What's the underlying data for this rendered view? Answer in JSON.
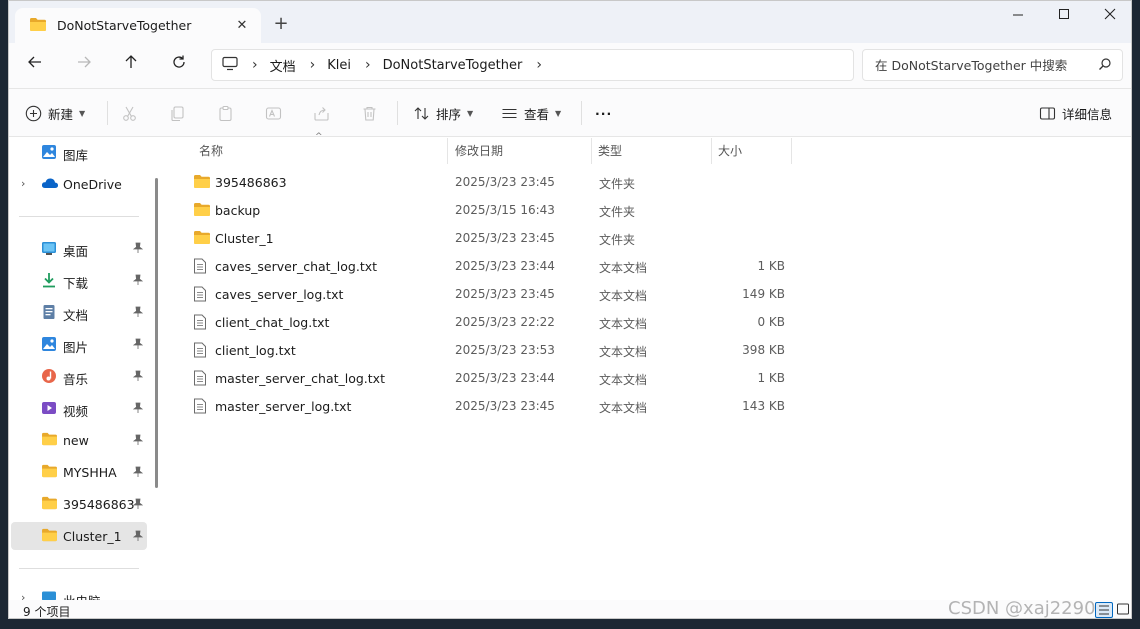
{
  "tab": {
    "title": "DoNotStarveTogether",
    "close_glyph": "✕",
    "new_tab_glyph": "+"
  },
  "window_controls": {
    "minimize": "—",
    "maximize": "☐",
    "close": "✕"
  },
  "breadcrumb": [
    "文档",
    "Klei",
    "DoNotStarveTogether"
  ],
  "search": {
    "placeholder": "在 DoNotStarveTogether 中搜索"
  },
  "toolbar": {
    "new_label": "新建",
    "sort_label": "排序",
    "view_label": "查看",
    "more_label": "···",
    "details_label": "详细信息"
  },
  "sidebar": {
    "top": [
      {
        "label": "图库",
        "icon": "gallery-icon"
      },
      {
        "label": "OneDrive",
        "icon": "onedrive-icon"
      }
    ],
    "pinned": [
      {
        "label": "桌面",
        "icon": "desktop-icon"
      },
      {
        "label": "下载",
        "icon": "download-icon"
      },
      {
        "label": "文档",
        "icon": "documents-icon"
      },
      {
        "label": "图片",
        "icon": "pictures-icon"
      },
      {
        "label": "音乐",
        "icon": "music-icon"
      },
      {
        "label": "视频",
        "icon": "videos-icon"
      },
      {
        "label": "new",
        "icon": "folder-icon"
      },
      {
        "label": "MYSHHA",
        "icon": "folder-icon"
      },
      {
        "label": "395486863",
        "icon": "folder-icon"
      },
      {
        "label": "Cluster_1",
        "icon": "folder-icon"
      }
    ],
    "this_pc": "此电脑"
  },
  "columns": {
    "name": "名称",
    "date": "修改日期",
    "type": "类型",
    "size": "大小"
  },
  "files": [
    {
      "name": "395486863",
      "date": "2025/3/23 23:45",
      "type": "文件夹",
      "size": "",
      "kind": "folder"
    },
    {
      "name": "backup",
      "date": "2025/3/15 16:43",
      "type": "文件夹",
      "size": "",
      "kind": "folder"
    },
    {
      "name": "Cluster_1",
      "date": "2025/3/23 23:45",
      "type": "文件夹",
      "size": "",
      "kind": "folder"
    },
    {
      "name": "caves_server_chat_log.txt",
      "date": "2025/3/23 23:44",
      "type": "文本文档",
      "size": "1 KB",
      "kind": "text"
    },
    {
      "name": "caves_server_log.txt",
      "date": "2025/3/23 23:45",
      "type": "文本文档",
      "size": "149 KB",
      "kind": "text"
    },
    {
      "name": "client_chat_log.txt",
      "date": "2025/3/23 22:22",
      "type": "文本文档",
      "size": "0 KB",
      "kind": "text"
    },
    {
      "name": "client_log.txt",
      "date": "2025/3/23 23:53",
      "type": "文本文档",
      "size": "398 KB",
      "kind": "text"
    },
    {
      "name": "master_server_chat_log.txt",
      "date": "2025/3/23 23:44",
      "type": "文本文档",
      "size": "1 KB",
      "kind": "text"
    },
    {
      "name": "master_server_log.txt",
      "date": "2025/3/23 23:45",
      "type": "文本文档",
      "size": "143 KB",
      "kind": "text"
    }
  ],
  "status": {
    "count": "9 个项目"
  },
  "watermark": "CSDN @xaj2290",
  "colors": {
    "folder": "#f4c430",
    "accent": "#0067c0",
    "selected_bg": "#e5e5e5"
  }
}
